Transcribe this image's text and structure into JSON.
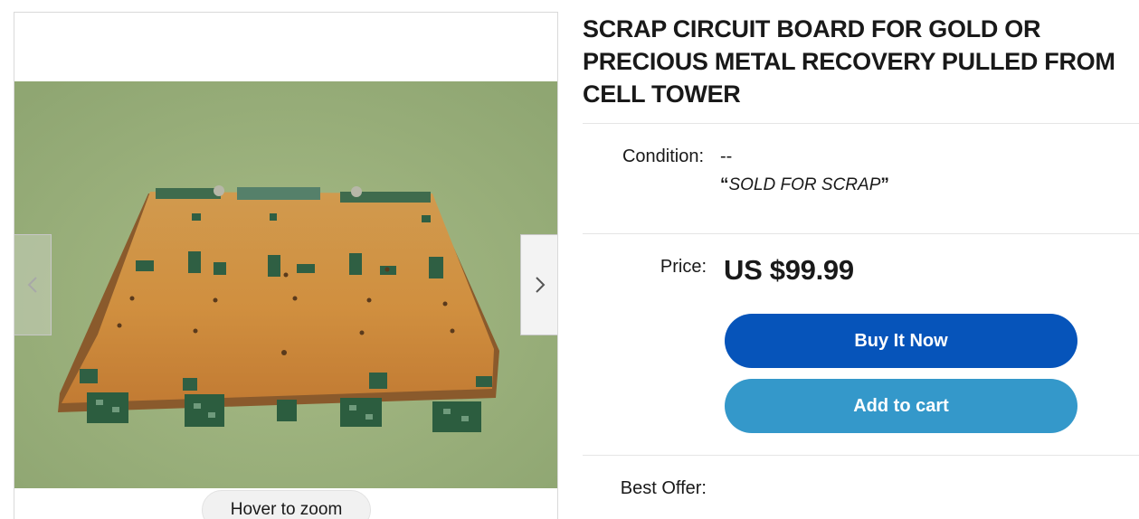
{
  "listing": {
    "title": "SCRAP CIRCUIT BOARD FOR GOLD OR PRECIOUS METAL RECOVERY PULLED FROM CELL TOWER",
    "condition_label": "Condition:",
    "condition_value": "--",
    "condition_note": "SOLD FOR SCRAP",
    "price_label": "Price:",
    "price": "US $99.99",
    "best_offer_label": "Best Offer:"
  },
  "gallery": {
    "zoom_hint": "Hover to zoom",
    "prev_icon": "chevron-left-icon",
    "next_icon": "chevron-right-icon"
  },
  "actions": {
    "buy_now": "Buy It Now",
    "add_to_cart": "Add to cart"
  },
  "colors": {
    "buy_now_bg": "#0654ba",
    "add_to_cart_bg": "#3498ca",
    "text": "#191919"
  }
}
